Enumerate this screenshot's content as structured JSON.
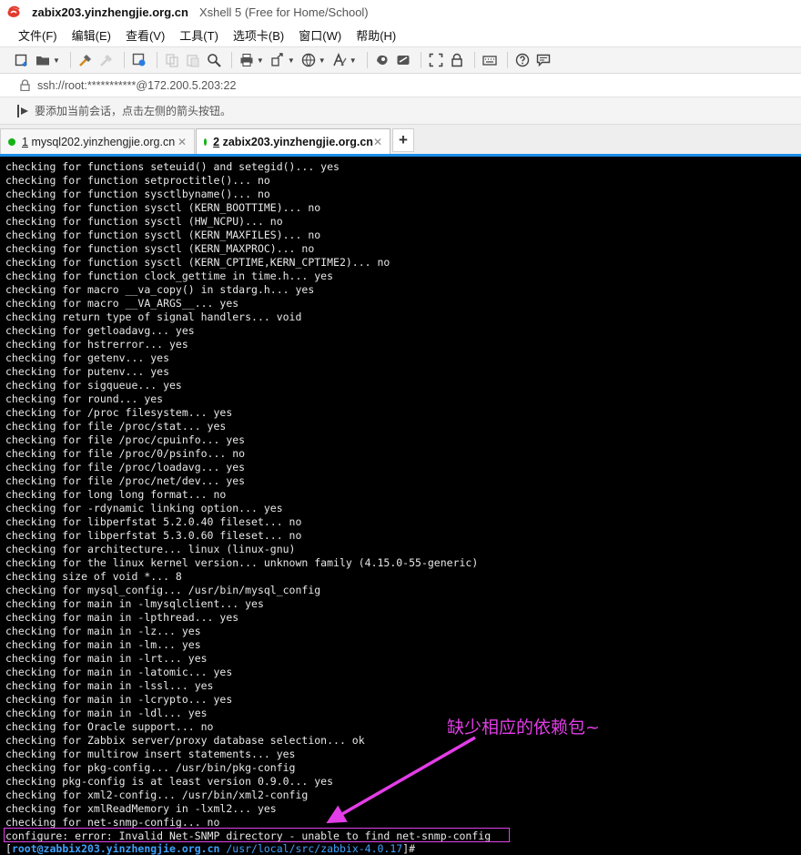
{
  "window": {
    "host_title": "zabix203.yinzhengjie.org.cn",
    "app_title": "Xshell 5 (Free for Home/School)"
  },
  "menu": [
    "文件(F)",
    "编辑(E)",
    "查看(V)",
    "工具(T)",
    "选项卡(B)",
    "窗口(W)",
    "帮助(H)"
  ],
  "toolbar_icons": [
    "new-session-icon",
    "open-folder-icon",
    "reconnect-icon",
    "disconnect-icon",
    "properties-icon",
    "copy-icon",
    "paste-icon",
    "find-icon",
    "print-icon",
    "transfer-icon",
    "globe-icon",
    "font-icon",
    "xftp-icon",
    "xagent-icon",
    "fullscreen-icon",
    "lock-icon",
    "keyboard-icon",
    "help-icon",
    "chat-icon"
  ],
  "address": {
    "text": "ssh://root:***********@172.200.5.203:22"
  },
  "hint": {
    "text": "要添加当前会话，点击左侧的箭头按钮。"
  },
  "tabs": [
    {
      "number": "1",
      "label": "mysql202.yinzhengjie.org.cn",
      "active": false
    },
    {
      "number": "2",
      "label": "zabix203.yinzhengjie.org.cn",
      "active": true
    }
  ],
  "colors": {
    "accent": "#1c8ce8",
    "terminal_bg": "#000000",
    "terminal_fg": "#e8e8e8",
    "prompt_blue": "#3ea2ff",
    "annotation_magenta": "#e23de6",
    "status_green": "#15b315"
  },
  "terminal": {
    "lines": [
      "checking for functions seteuid() and setegid()... yes",
      "checking for function setproctitle()... no",
      "checking for function sysctlbyname()... no",
      "checking for function sysctl (KERN_BOOTTIME)... no",
      "checking for function sysctl (HW_NCPU)... no",
      "checking for function sysctl (KERN_MAXFILES)... no",
      "checking for function sysctl (KERN_MAXPROC)... no",
      "checking for function sysctl (KERN_CPTIME,KERN_CPTIME2)... no",
      "checking for function clock_gettime in time.h... yes",
      "checking for macro __va_copy() in stdarg.h... yes",
      "checking for macro __VA_ARGS__... yes",
      "checking return type of signal handlers... void",
      "checking for getloadavg... yes",
      "checking for hstrerror... yes",
      "checking for getenv... yes",
      "checking for putenv... yes",
      "checking for sigqueue... yes",
      "checking for round... yes",
      "checking for /proc filesystem... yes",
      "checking for file /proc/stat... yes",
      "checking for file /proc/cpuinfo... yes",
      "checking for file /proc/0/psinfo... no",
      "checking for file /proc/loadavg... yes",
      "checking for file /proc/net/dev... yes",
      "checking for long long format... no",
      "checking for -rdynamic linking option... yes",
      "checking for libperfstat 5.2.0.40 fileset... no",
      "checking for libperfstat 5.3.0.60 fileset... no",
      "checking for architecture... linux (linux-gnu)",
      "checking for the linux kernel version... unknown family (4.15.0-55-generic)",
      "checking size of void *... 8",
      "checking for mysql_config... /usr/bin/mysql_config",
      "checking for main in -lmysqlclient... yes",
      "checking for main in -lpthread... yes",
      "checking for main in -lz... yes",
      "checking for main in -lm... yes",
      "checking for main in -lrt... yes",
      "checking for main in -latomic... yes",
      "checking for main in -lssl... yes",
      "checking for main in -lcrypto... yes",
      "checking for main in -ldl... yes",
      "checking for Oracle support... no",
      "checking for Zabbix server/proxy database selection... ok",
      "checking for multirow insert statements... yes",
      "checking for pkg-config... /usr/bin/pkg-config",
      "checking pkg-config is at least version 0.9.0... yes",
      "checking for xml2-config... /usr/bin/xml2-config",
      "checking for xmlReadMemory in -lxml2... yes",
      "checking for net-snmp-config... no",
      "configure: error: Invalid Net-SNMP directory - unable to find net-snmp-config"
    ],
    "prompt": {
      "open": "[",
      "user_host": "root@zabbix203.yinzhengjie.org.cn",
      "path": " /usr/local/src/zabbix-4.0.17",
      "close": "]#"
    }
  },
  "annotation": {
    "text": "缺少相应的依赖包~"
  }
}
